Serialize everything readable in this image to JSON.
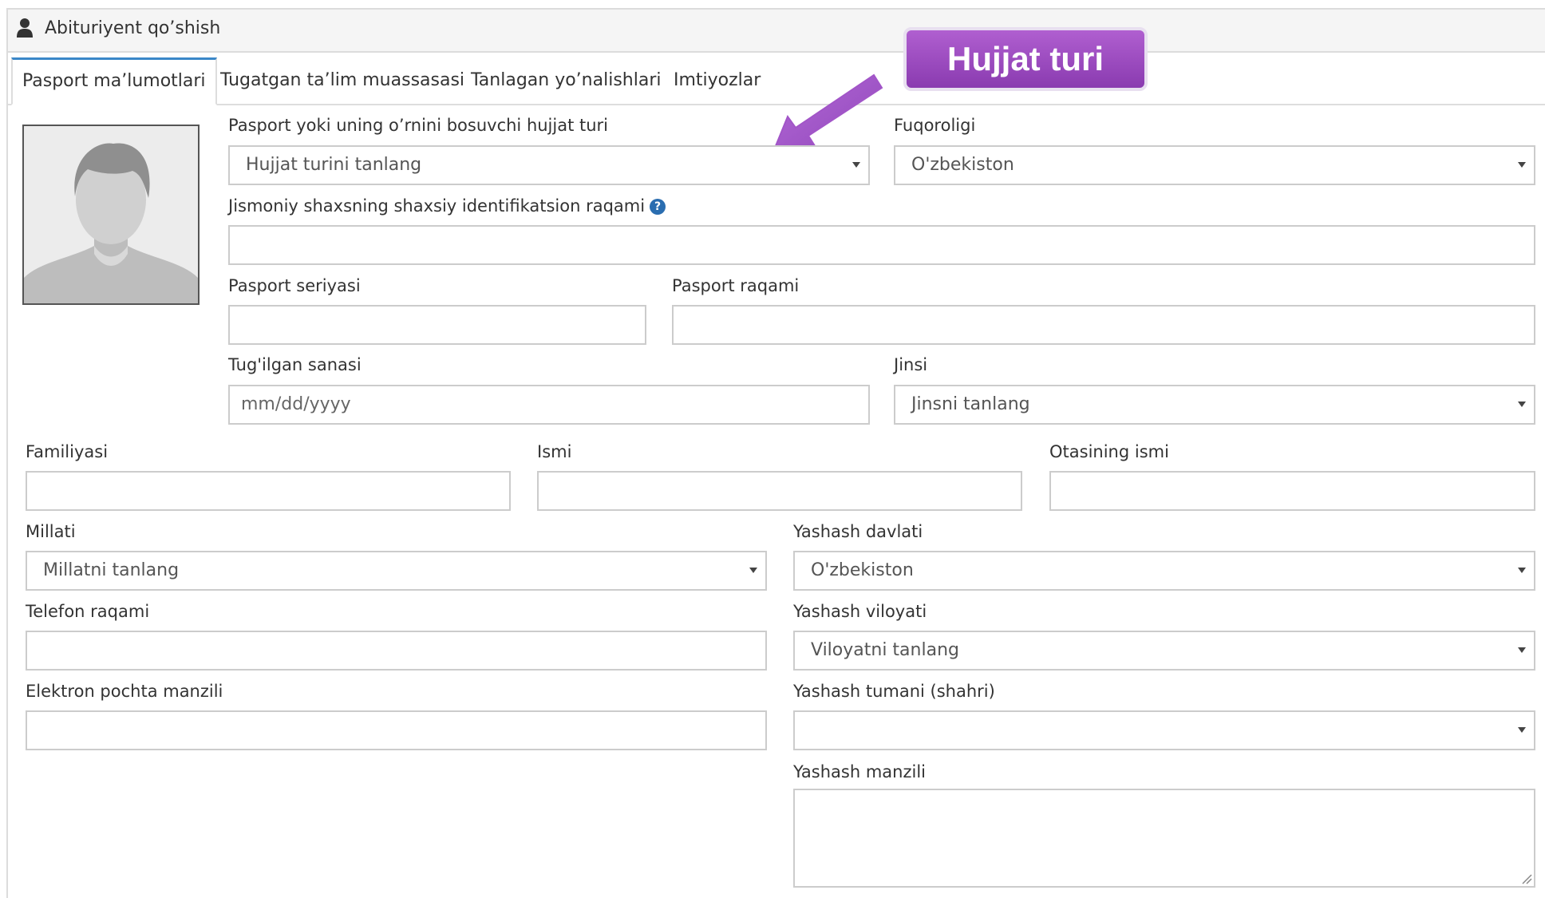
{
  "header": {
    "title": "Abituriyent qo’shish",
    "icon": "user-icon"
  },
  "tabs": [
    {
      "label": "Pasport ma’lumotlari",
      "active": true
    },
    {
      "label": "Tugatgan ta’lim muassasasi",
      "active": false
    },
    {
      "label": "Tanlagan yo’nalishlari",
      "active": false
    },
    {
      "label": "Imtiyozlar",
      "active": false
    }
  ],
  "annotation": {
    "text": "Hujjat turi",
    "color": "#9b4fc4"
  },
  "form": {
    "doc_type": {
      "label": "Pasport yoki uning o’rnini bosuvchi hujjat turi",
      "value": "Hujjat turini tanlang"
    },
    "citizenship": {
      "label": "Fuqoroligi",
      "value": "O'zbekiston"
    },
    "pinfl": {
      "label": "Jismoniy shaxsning shaxsiy identifikatsion raqami",
      "value": ""
    },
    "passport_series": {
      "label": "Pasport seriyasi",
      "value": ""
    },
    "passport_number": {
      "label": "Pasport raqami",
      "value": ""
    },
    "birth_date": {
      "label": "Tug'ilgan sanasi",
      "placeholder": "mm/dd/yyyy"
    },
    "gender": {
      "label": "Jinsi",
      "value": "Jinsni tanlang"
    },
    "last_name": {
      "label": "Familiyasi",
      "value": ""
    },
    "first_name": {
      "label": "Ismi",
      "value": ""
    },
    "patronymic": {
      "label": "Otasining ismi",
      "value": ""
    },
    "nationality": {
      "label": "Millati",
      "value": "Millatni tanlang"
    },
    "country": {
      "label": "Yashash davlati",
      "value": "O'zbekiston"
    },
    "phone": {
      "label": "Telefon raqami",
      "value": ""
    },
    "region": {
      "label": "Yashash viloyati",
      "value": "Viloyatni tanlang"
    },
    "email": {
      "label": "Elektron pochta manzili",
      "value": ""
    },
    "district": {
      "label": "Yashash tumani (shahri)",
      "value": ""
    },
    "address": {
      "label": "Yashash manzili",
      "value": ""
    }
  }
}
